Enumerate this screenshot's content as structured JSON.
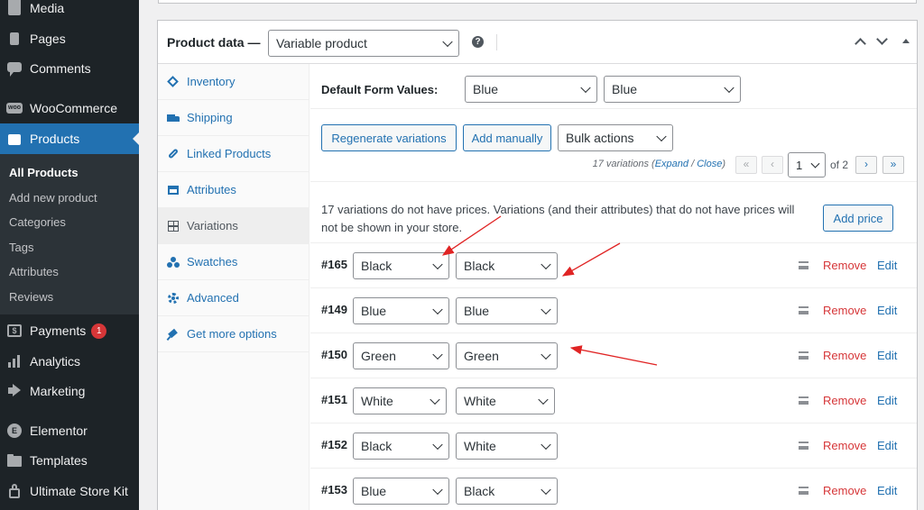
{
  "sidebar": {
    "items": [
      {
        "label": "Media",
        "icon": "media-icon"
      },
      {
        "label": "Pages",
        "icon": "pages-icon"
      },
      {
        "label": "Comments",
        "icon": "comments-icon"
      },
      {
        "label": "WooCommerce",
        "icon": "woocommerce-icon"
      },
      {
        "label": "Products",
        "icon": "products-icon"
      },
      {
        "label": "Payments",
        "icon": "payments-icon",
        "badge": "1"
      },
      {
        "label": "Analytics",
        "icon": "analytics-icon"
      },
      {
        "label": "Marketing",
        "icon": "marketing-icon"
      },
      {
        "label": "Elementor",
        "icon": "elementor-icon"
      },
      {
        "label": "Templates",
        "icon": "templates-icon"
      },
      {
        "label": "Ultimate Store Kit",
        "icon": "store-kit-icon"
      }
    ],
    "submenu": [
      "All Products",
      "Add new product",
      "Categories",
      "Tags",
      "Attributes",
      "Reviews"
    ]
  },
  "product_data": {
    "title": "Product data —",
    "type_select": "Variable product",
    "help": "?"
  },
  "tabs": [
    {
      "label": "Inventory",
      "icon": "inventory-icon"
    },
    {
      "label": "Shipping",
      "icon": "shipping-icon"
    },
    {
      "label": "Linked Products",
      "icon": "link-icon"
    },
    {
      "label": "Attributes",
      "icon": "attributes-icon"
    },
    {
      "label": "Variations",
      "icon": "variations-icon"
    },
    {
      "label": "Swatches",
      "icon": "swatches-icon"
    },
    {
      "label": "Advanced",
      "icon": "gear-icon"
    },
    {
      "label": "Get more options",
      "icon": "plugin-icon"
    }
  ],
  "defaults": {
    "label": "Default Form Values:",
    "select1": "Blue",
    "select2": "Blue"
  },
  "toolbar": {
    "regenerate": "Regenerate variations",
    "add_manually": "Add manually",
    "bulk_actions": "Bulk actions",
    "count_text": "17 variations (",
    "expand": "Expand",
    "slash": " / ",
    "close": "Close",
    "close_paren": ")",
    "first": "«",
    "prev": "‹",
    "page": "1",
    "of_pages": "of 2",
    "next": "›",
    "last": "»"
  },
  "notice": {
    "text": "17 variations do not have prices. Variations (and their attributes) that do not have prices will not be shown in your store.",
    "button": "Add price"
  },
  "variations": [
    {
      "id": "#165",
      "attr1": "Black",
      "attr2": "Black",
      "remove": "Remove",
      "edit": "Edit"
    },
    {
      "id": "#149",
      "attr1": "Blue",
      "attr2": "Blue",
      "remove": "Remove",
      "edit": "Edit"
    },
    {
      "id": "#150",
      "attr1": "Green",
      "attr2": "Green",
      "remove": "Remove",
      "edit": "Edit"
    },
    {
      "id": "#151",
      "attr1": "White",
      "attr2": "White",
      "remove": "Remove",
      "edit": "Edit"
    },
    {
      "id": "#152",
      "attr1": "Black",
      "attr2": "White",
      "remove": "Remove",
      "edit": "Edit"
    },
    {
      "id": "#153",
      "attr1": "Blue",
      "attr2": "Black",
      "remove": "Remove",
      "edit": "Edit"
    }
  ],
  "colors": {
    "sidebar_bg": "#1d2327",
    "accent": "#2271b1",
    "remove": "#d63638",
    "annotation_arrow": "#e02424"
  }
}
